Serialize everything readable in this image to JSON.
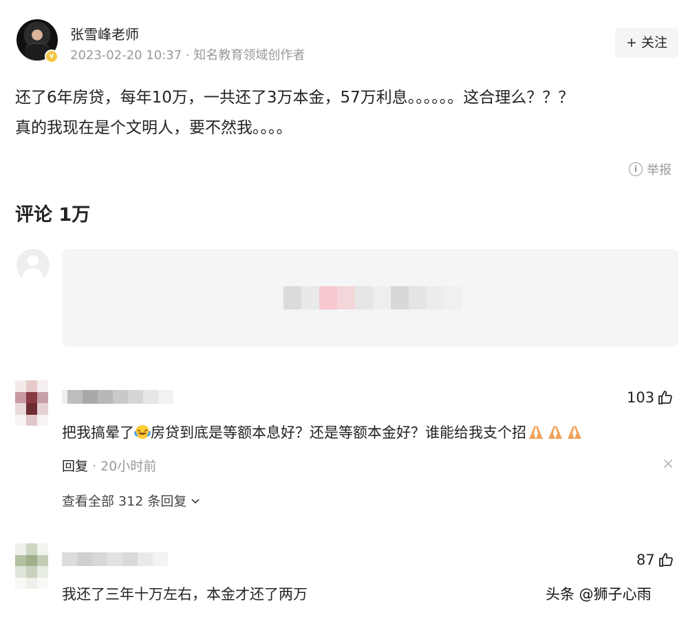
{
  "author": {
    "name": "张雪峰老师",
    "meta": "2023-02-20 10:37 · 知名教育领域创作者",
    "follow_label": "+ 关注"
  },
  "post": {
    "line1": "还了6年房贷，每年10万，一共还了3万本金，57万利息。。。。。。这合理么？？？",
    "line2": "真的我现在是个文明人，要不然我。。。。"
  },
  "report_label": "举报",
  "comments_header": "评论 1万",
  "comments": [
    {
      "likes": "103",
      "text": "把我搞晕了",
      "text_after_emoji": "房贷到底是等额本息好？还是等额本金好？谁能给我支个招",
      "time": "20小时前",
      "reply_label": "回复",
      "view_replies": "查看全部 312 条回复"
    },
    {
      "likes": "87",
      "text": "我还了三年十万左右，本金才还了两万"
    }
  ],
  "watermark": "头条 @狮子心雨",
  "icons": {
    "verified": "verified-badge-icon",
    "info": "info-icon",
    "like": "thumbs-up-icon",
    "close": "close-icon",
    "chevron": "chevron-down-icon",
    "emoji_cry": "crying-laughing-emoji",
    "emoji_pray": "praying-hands-emoji"
  },
  "colors": {
    "muted_text": "#999999",
    "input_bg": "#f4f5f6",
    "follow_bg": "#f4f5f6",
    "verified": "#f5c542"
  }
}
